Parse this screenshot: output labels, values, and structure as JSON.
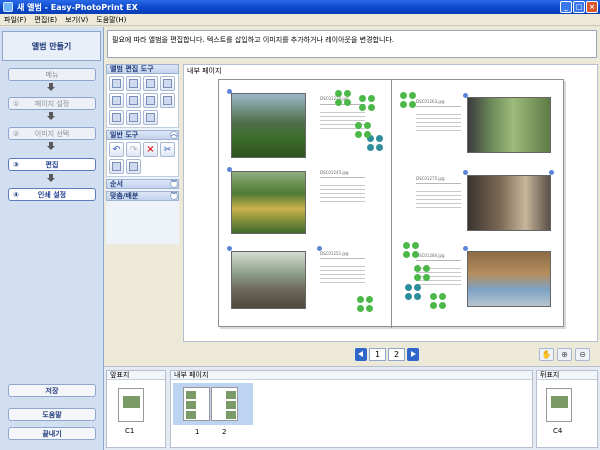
{
  "window": {
    "title": "새 앨범 - Easy-PhotoPrint EX"
  },
  "menu": [
    "파일(F)",
    "편집(E)",
    "보기(V)",
    "도움말(H)"
  ],
  "left_panel": {
    "header": "앨범 만들기",
    "menu_button": "메뉴",
    "steps": [
      {
        "num": "①",
        "label": "페이지 설정"
      },
      {
        "num": "②",
        "label": "이미지 선택"
      },
      {
        "num": "③",
        "label": "편집"
      },
      {
        "num": "④",
        "label": "인쇄 설정"
      }
    ],
    "save": "저장",
    "help": "도움말",
    "exit": "끝내기"
  },
  "instruction": "필요에 따라 앨범을 편집합니다. 텍스트를 삽입하고 이미지를 추가하거나 레이아웃을 변경합니다.",
  "tools": {
    "album_edit": "앨범 편집 도구",
    "general": "일반 도구",
    "order": "순서",
    "align": "맞춤/배분",
    "album_icons": [
      "layout-icon",
      "background-icon",
      "add-image-icon",
      "frame-icon",
      "text-icon",
      "date-icon",
      "clipart-icon",
      "effect-icon",
      "text-box-icon",
      "comment-icon",
      "stamp-icon"
    ],
    "general_icons": [
      "undo-icon",
      "redo-icon",
      "delete-icon",
      "cut-icon",
      "copy-icon",
      "paste-icon"
    ]
  },
  "canvas": {
    "label": "내부 페이지",
    "captions": [
      "DSC01234.jpg",
      "DSC01245.jpg",
      "DSC01251.jpg",
      "DSC01263.jpg",
      "DSC01275.jpg",
      "DSC01284.jpg"
    ]
  },
  "pager": {
    "pages": [
      "1",
      "2"
    ]
  },
  "zoom": {
    "icons": [
      "hand-icon",
      "zoom-in-icon",
      "zoom-out-icon"
    ]
  },
  "bottom": {
    "front_cover": "앞표지",
    "inner_pages": "내부 페이지",
    "back_cover": "뒤표지",
    "thumbs": {
      "front": "C1",
      "p1": "1",
      "p2": "2",
      "back": "C4"
    }
  }
}
